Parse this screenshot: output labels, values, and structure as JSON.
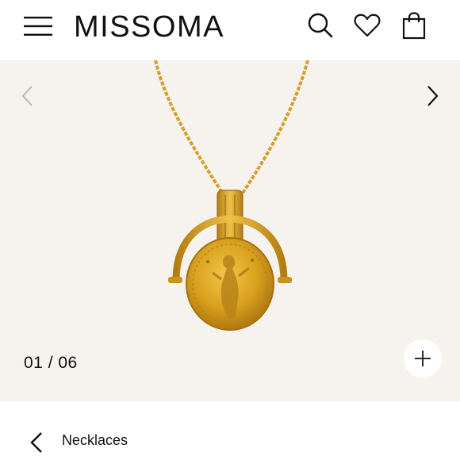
{
  "header": {
    "brand": "MISSOMA",
    "icons": [
      "menu-icon",
      "search-icon",
      "heart-icon",
      "bag-icon"
    ]
  },
  "gallery": {
    "counter": "01 / 06",
    "current_index": 1,
    "total": 6,
    "product_colors": {
      "gold": "#d9a21e",
      "gold_dark": "#a8700d",
      "background": "#f6f3ef"
    }
  },
  "breadcrumb": {
    "label": "Necklaces"
  }
}
